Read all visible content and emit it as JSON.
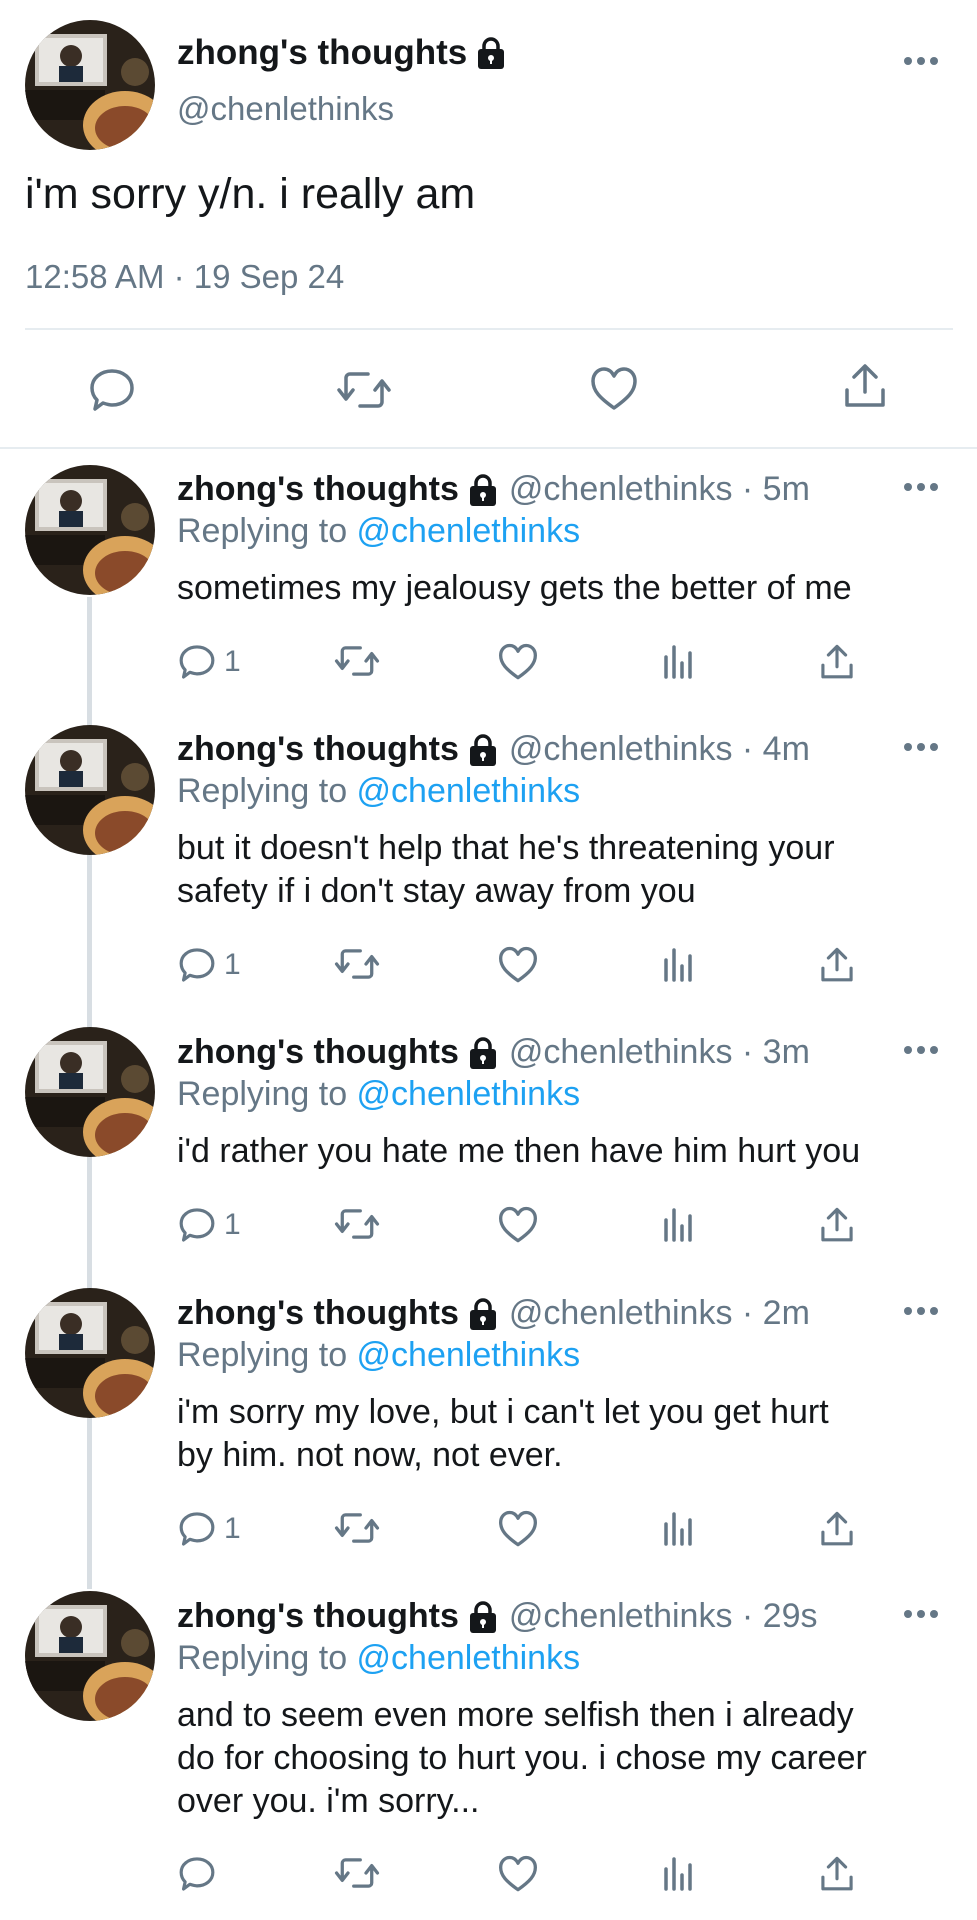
{
  "main_tweet": {
    "display_name": "zhong's thoughts",
    "handle": "@chenlethinks",
    "text": "i'm sorry y/n. i really am",
    "timestamp": "12:58 AM · 19 Sep 24",
    "icons": [
      "reply-icon",
      "retweet-icon",
      "like-icon",
      "share-icon",
      "more-icon",
      "lock-icon"
    ]
  },
  "replies": [
    {
      "display_name": "zhong's thoughts",
      "handle": "@chenlethinks",
      "time": "5m",
      "replying_prefix": "Replying to ",
      "replying_to": "@chenlethinks",
      "lines": [
        "sometimes my jealousy gets the better of me"
      ],
      "reply_count": "1"
    },
    {
      "display_name": "zhong's thoughts",
      "handle": "@chenlethinks",
      "time": "4m",
      "replying_prefix": "Replying to ",
      "replying_to": "@chenlethinks",
      "lines": [
        "but it doesn't help that he's threatening your",
        "safety if i don't stay away from you"
      ],
      "reply_count": "1"
    },
    {
      "display_name": "zhong's thoughts",
      "handle": "@chenlethinks",
      "time": "3m",
      "replying_prefix": "Replying to ",
      "replying_to": "@chenlethinks",
      "lines": [
        "i'd rather you hate me then have him hurt you"
      ],
      "reply_count": "1"
    },
    {
      "display_name": "zhong's thoughts",
      "handle": "@chenlethinks",
      "time": "2m",
      "replying_prefix": "Replying to ",
      "replying_to": "@chenlethinks",
      "lines": [
        "i'm sorry my love, but i can't let you get hurt",
        "by him. not now, not ever."
      ],
      "reply_count": "1"
    },
    {
      "display_name": "zhong's thoughts",
      "handle": "@chenlethinks",
      "time": "29s",
      "replying_prefix": "Replying to ",
      "replying_to": "@chenlethinks",
      "lines": [
        "and to seem even more selfish then i already",
        "do for choosing to hurt you. i chose my career",
        "over you. i'm sorry..."
      ],
      "reply_count": ""
    }
  ],
  "colors": {
    "text": "#14171a",
    "secondary": "#657786",
    "link": "#1da1f2",
    "divider": "#e6ecf0",
    "thread_line": "#d8dee3"
  }
}
